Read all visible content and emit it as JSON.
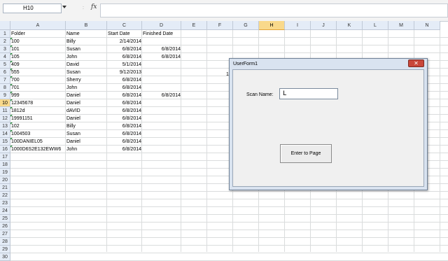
{
  "name_box": {
    "value": "H10"
  },
  "formula_bar": {
    "fx_label": "fx",
    "value": "",
    "separator": ":"
  },
  "columns": [
    "A",
    "B",
    "C",
    "D",
    "E",
    "F",
    "G",
    "H",
    "I",
    "J",
    "K",
    "L",
    "M",
    "N"
  ],
  "selected_column": "H",
  "selected_row": 10,
  "rows": [
    1,
    2,
    3,
    4,
    5,
    6,
    7,
    8,
    9,
    10,
    11,
    12,
    13,
    14,
    15,
    16,
    17,
    18,
    19,
    20,
    21,
    22,
    23,
    24,
    25,
    26,
    27,
    28,
    29,
    30
  ],
  "headers": [
    "Folder",
    "Name",
    "Start Date",
    "Finished Date"
  ],
  "data_rows": [
    {
      "folder": "100",
      "name": "Billy",
      "start": "2/14/2014",
      "finished": ""
    },
    {
      "folder": "101",
      "name": "Susan",
      "start": "6/8/2014",
      "finished": "6/8/2014"
    },
    {
      "folder": "105",
      "name": "John",
      "start": "6/8/2014",
      "finished": "6/8/2014"
    },
    {
      "folder": "409",
      "name": "David",
      "start": "5/1/2014",
      "finished": ""
    },
    {
      "folder": "555",
      "name": "Susan",
      "start": "9/12/2013",
      "finished": ""
    },
    {
      "folder": "700",
      "name": "Sherry",
      "start": "6/8/2014",
      "finished": ""
    },
    {
      "folder": "701",
      "name": "John",
      "start": "6/8/2014",
      "finished": ""
    },
    {
      "folder": "999",
      "name": "Daniel",
      "start": "6/8/2014",
      "finished": "6/8/2014"
    },
    {
      "folder": "12345678",
      "name": "Daniel",
      "start": "6/8/2014",
      "finished": ""
    },
    {
      "folder": "1812d",
      "name": "dAVID",
      "start": "6/8/2014",
      "finished": ""
    },
    {
      "folder": "19991151",
      "name": "Daniel",
      "start": "6/8/2014",
      "finished": ""
    },
    {
      "folder": "102",
      "name": "Billy",
      "start": "6/8/2014",
      "finished": ""
    },
    {
      "folder": "1004503",
      "name": "Susan",
      "start": "6/8/2014",
      "finished": ""
    },
    {
      "folder": "100DANIEL05",
      "name": "Daniel",
      "start": "6/8/2014",
      "finished": ""
    },
    {
      "folder": "1000D6S2E132EWW6",
      "name": "John",
      "start": "6/8/2014",
      "finished": ""
    }
  ],
  "peek_text": "1",
  "dialog": {
    "title": "UserForm1",
    "close_label": "✕",
    "scan_label": "Scan Name:",
    "scan_value": "L",
    "enter_button": "Enter to Page"
  }
}
